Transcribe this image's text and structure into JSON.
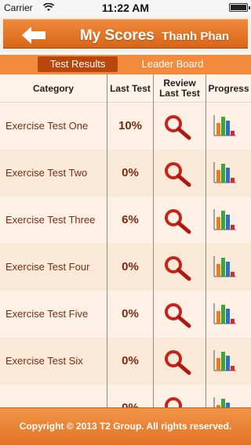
{
  "status_bar": {
    "carrier": "Carrier",
    "time": "11:22 AM"
  },
  "header": {
    "title": "My Scores",
    "user_name": "Thanh Phan",
    "back_icon": "arrow-left-icon"
  },
  "tabs": [
    {
      "label": "Test Results",
      "active": true
    },
    {
      "label": "Leader Board",
      "active": false
    }
  ],
  "table": {
    "columns": [
      "Category",
      "Last Test",
      "Review Last Test",
      "Progress"
    ],
    "column_lines": {
      "review": [
        "Review",
        "Last Test"
      ]
    },
    "rows": [
      {
        "category": "Exercise Test One",
        "last_test": "10%"
      },
      {
        "category": "Exercise Test Two",
        "last_test": "0%"
      },
      {
        "category": "Exercise Test Three",
        "last_test": "6%"
      },
      {
        "category": "Exercise Test Four",
        "last_test": "0%"
      },
      {
        "category": "Exercise Test Five",
        "last_test": "0%"
      },
      {
        "category": "Exercise Test Six",
        "last_test": "0%"
      },
      {
        "category": "",
        "last_test": "0%"
      }
    ]
  },
  "footer": {
    "copyright": "Copyright © 2013 T2 Group. All rights reserved."
  },
  "colors": {
    "accent": "#f38a3c",
    "tab_active": "#b9460d",
    "text_dark_red": "#7a2a12"
  }
}
